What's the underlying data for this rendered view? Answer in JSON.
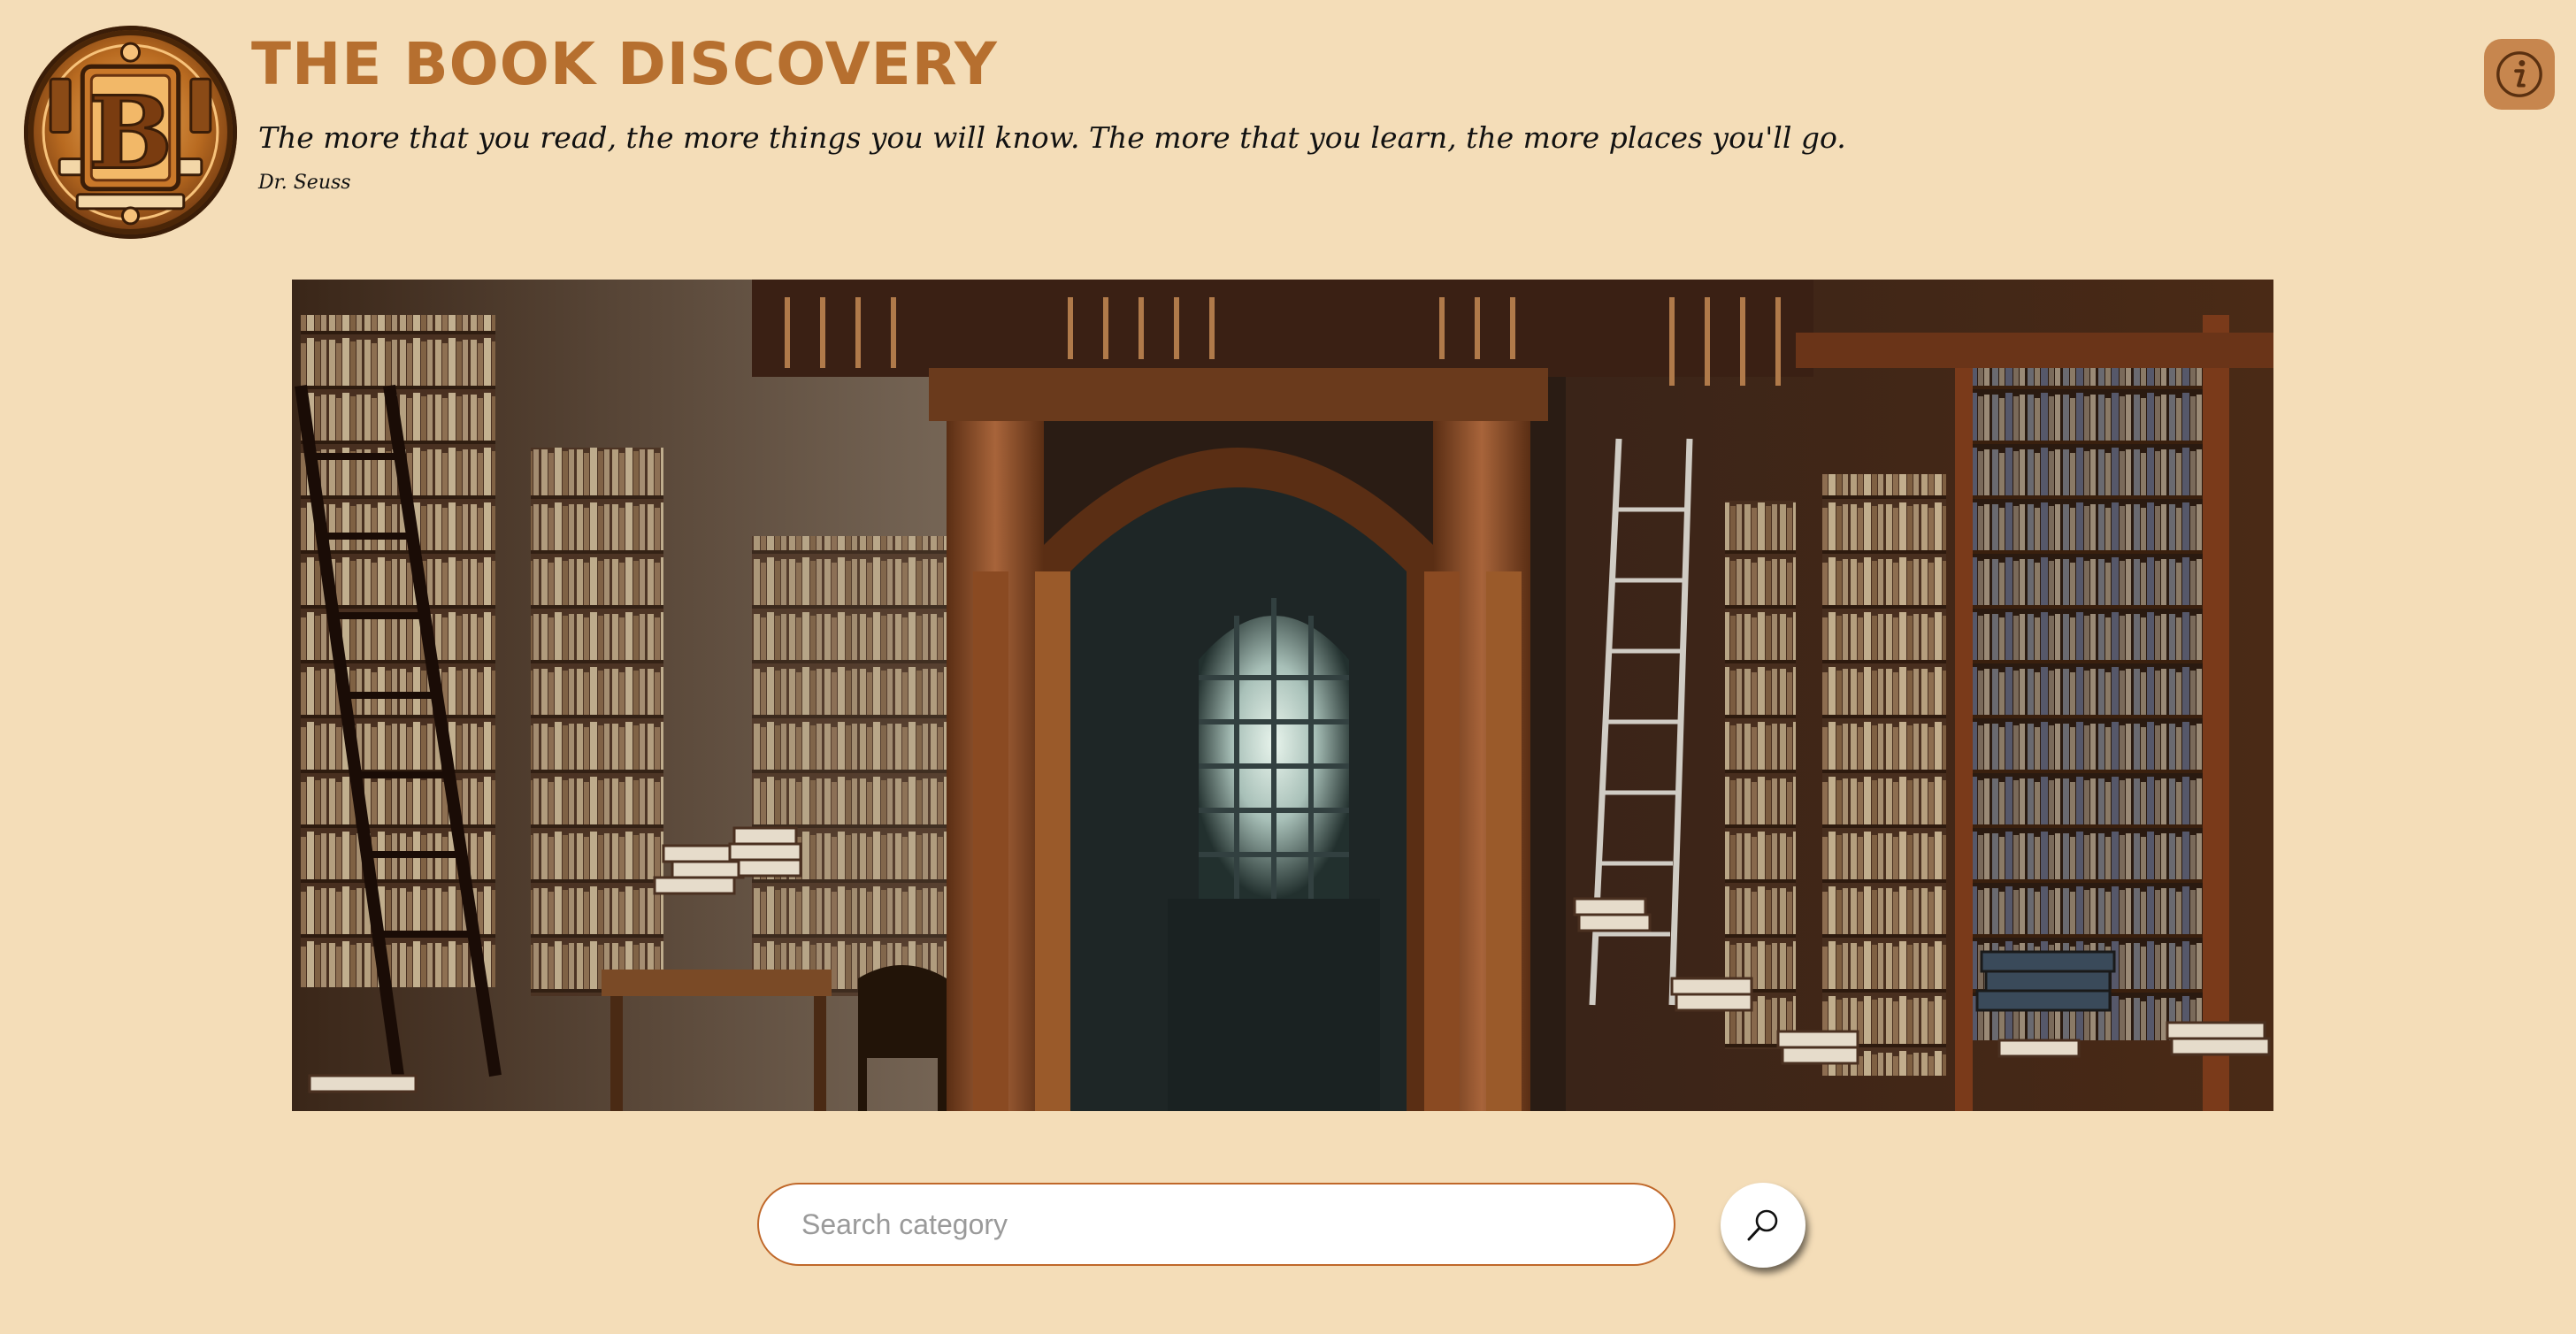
{
  "header": {
    "title": "THE BOOK DISCOVERY",
    "quote": "The more that you read, the more things you will know. The more that you learn, the more places you'll go.",
    "quote_author": "Dr. Seuss",
    "logo_letter": "B",
    "info_icon": "info-icon"
  },
  "hero": {
    "subject": "library-interior-image"
  },
  "search": {
    "placeholder": "Search category",
    "value": "",
    "button_icon": "search-icon"
  },
  "colors": {
    "page_background": "#f4ddb8",
    "title": "#b66f2f",
    "info_button": "#c7864e",
    "search_border": "#c0682a"
  }
}
